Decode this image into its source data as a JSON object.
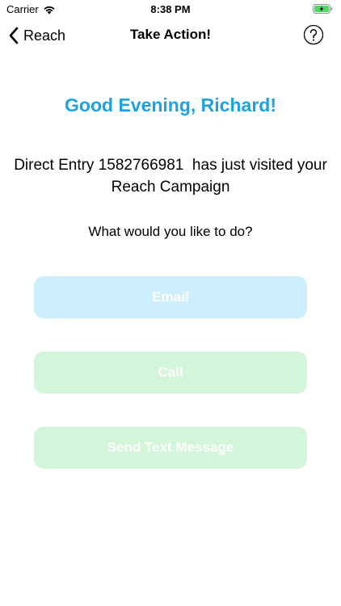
{
  "status_bar": {
    "carrier": "Carrier",
    "time": "8:38 PM"
  },
  "nav": {
    "back_label": "Reach",
    "title": "Take Action!",
    "help_icon": "question-circle-icon"
  },
  "content": {
    "greeting": "Good Evening, Richard!",
    "visit_line_1": "Direct Entry 1582766981  has just visited your",
    "visit_line_2": "Reach Campaign",
    "question": "What would you like to do?"
  },
  "actions": {
    "email_label": "Email",
    "call_label": "Call",
    "text_label": "Send Text Message"
  },
  "colors": {
    "accent": "#1ba3e0",
    "email_button": "#cdeefc",
    "call_button": "#d3f5d9",
    "text_button": "#d3f5d9",
    "battery": "#4cd964"
  }
}
